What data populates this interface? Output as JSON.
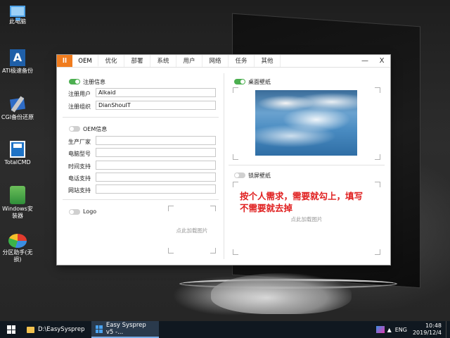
{
  "desktop": {
    "icons": [
      {
        "label": "此电脑"
      },
      {
        "label": "ATI极速备份"
      },
      {
        "label": "CGI备份还原"
      },
      {
        "label": "TotalCMD"
      },
      {
        "label": "Windows安装器"
      },
      {
        "label": "分区助手(无损)"
      }
    ]
  },
  "window": {
    "logo": "ll",
    "tabs": [
      {
        "label": "OEM"
      },
      {
        "label": "优化"
      },
      {
        "label": "部署"
      },
      {
        "label": "系统"
      },
      {
        "label": "用户"
      },
      {
        "label": "网络"
      },
      {
        "label": "任务"
      },
      {
        "label": "其他"
      }
    ],
    "minimize": "—",
    "close": "X",
    "registration": {
      "toggle_label": "注册信息",
      "user_label": "注册用户",
      "user_value": "Alkaid",
      "org_label": "注册组织",
      "org_value": "DianShouIT"
    },
    "oem_info": {
      "toggle_label": "OEM信息",
      "manufacturer_label": "生产厂家",
      "model_label": "电脑型号",
      "support_hours_label": "时间支持",
      "phone_label": "电话支持",
      "website_label": "网站支持"
    },
    "logo_section": {
      "toggle_label": "Logo",
      "hint": "点此加载图片"
    },
    "desktop_wallpaper": {
      "toggle_label": "桌面壁纸"
    },
    "lock_wallpaper": {
      "toggle_label": "锁屏壁纸",
      "hint": "点此加载图片"
    }
  },
  "annotation": {
    "line1": "按个人需求，需要就勾上，填写",
    "line2": "不需要就去掉"
  },
  "taskbar": {
    "items": [
      {
        "label": "D:\\EasySysprep"
      },
      {
        "label": "Easy Sysprep v5 -..."
      }
    ],
    "language": "ENG",
    "time": "10:48",
    "date": "2019/12/4"
  }
}
